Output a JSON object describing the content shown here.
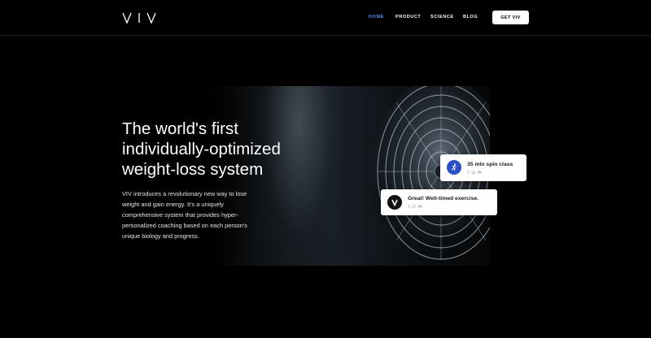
{
  "brand": {
    "logo_text": "VIV"
  },
  "nav": {
    "items": [
      {
        "label": "HOME",
        "active": true
      },
      {
        "label": "PRODUCT",
        "active": false
      },
      {
        "label": "SCIENCE",
        "active": false
      },
      {
        "label": "BLOG",
        "active": false
      }
    ],
    "cta_label": "GET VIV",
    "active_color": "#4d8df7"
  },
  "hero": {
    "headline_lines": [
      "The world's first",
      "individually-optimized",
      "weight-loss system"
    ],
    "description_lines": [
      "VIV introduces a revolutionary new way to lose",
      "weight and gain energy. It's a uniquely",
      "comprehensive system that provides hyper-",
      "personalized coaching based on each person's",
      "unique biology and progress."
    ]
  },
  "notifications": [
    {
      "title": "35 min spin class",
      "time": "7:16 PM",
      "icon": "running-person-icon",
      "icon_color": "#2b4fc7"
    },
    {
      "title": "Great! Well-timed exercise.",
      "time": "7:37 PM",
      "icon": "viv-v-logo-icon",
      "icon_color": "#111111"
    }
  ]
}
